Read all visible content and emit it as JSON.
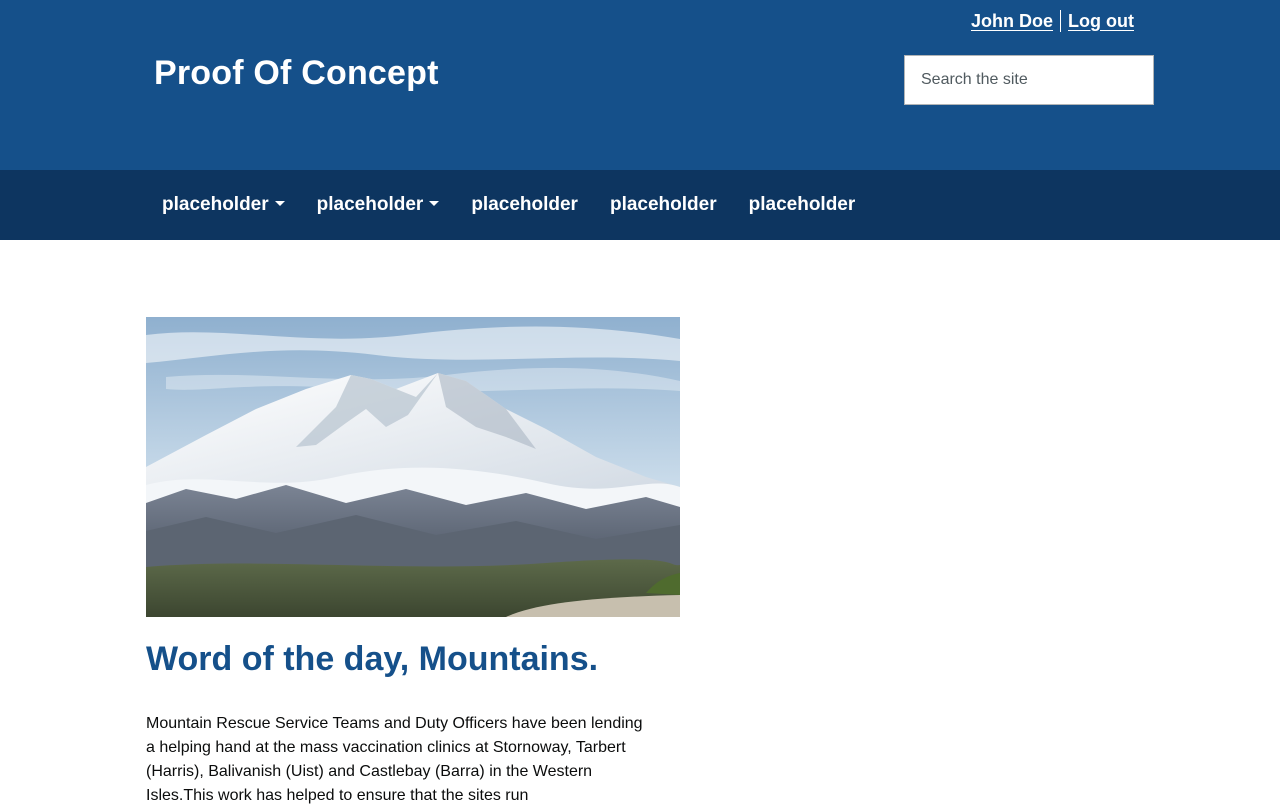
{
  "header": {
    "site_title": "Proof Of Concept",
    "user_name": "John Doe",
    "logout_label": "Log out",
    "search_placeholder": "Search the site",
    "search_value": ""
  },
  "nav": {
    "items": [
      {
        "label": "placeholder",
        "has_dropdown": true
      },
      {
        "label": "placeholder",
        "has_dropdown": true
      },
      {
        "label": "placeholder",
        "has_dropdown": false
      },
      {
        "label": "placeholder",
        "has_dropdown": false
      },
      {
        "label": "placeholder",
        "has_dropdown": false
      }
    ]
  },
  "article": {
    "image_subject": "snow-capped mountain above clouds",
    "title": "Word of the day, Mountains.",
    "body": "Mountain Rescue Service Teams and Duty Officers have been lending a helping hand at the mass vaccination clinics at Stornoway, Tarbert (Harris), Balivanish (Uist) and Castlebay (Barra) in the Western Isles.This work has helped to ensure that the sites run"
  },
  "colors": {
    "header_bg": "#15508a",
    "nav_bg": "#0d3560",
    "title_color": "#15508a",
    "text_color": "#0b0c0c"
  }
}
